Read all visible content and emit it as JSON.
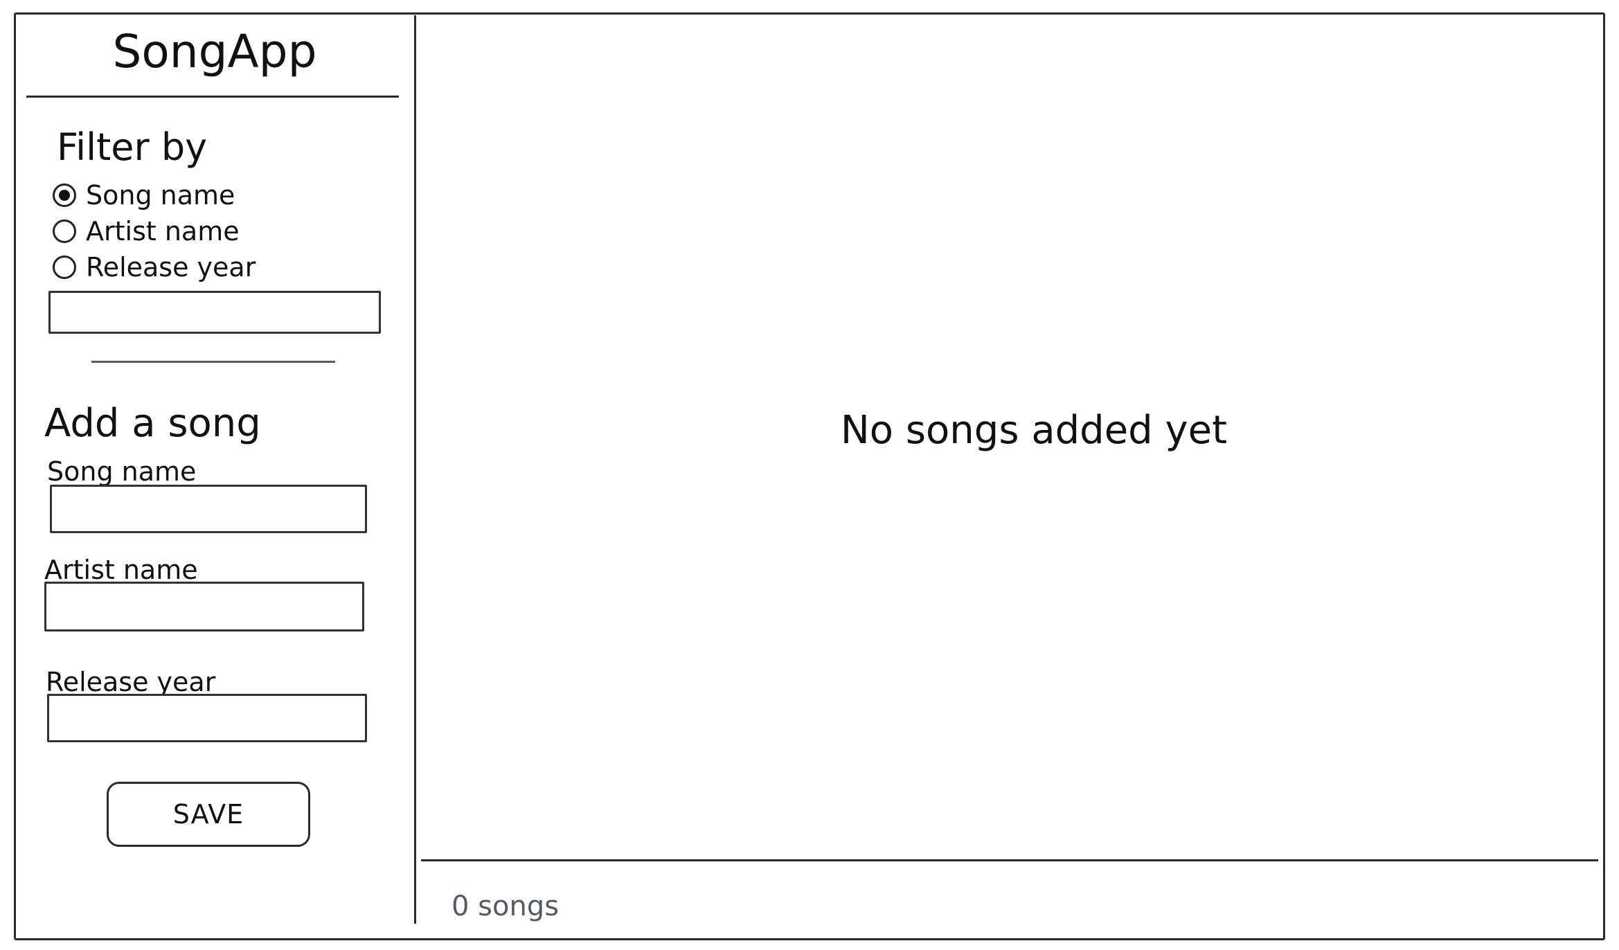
{
  "app": {
    "title": "SongApp"
  },
  "filter": {
    "title": "Filter by",
    "options": [
      {
        "label": "Song name",
        "selected": true
      },
      {
        "label": "Artist name",
        "selected": false
      },
      {
        "label": "Release year",
        "selected": false
      }
    ],
    "input_value": ""
  },
  "add_song": {
    "title": "Add a song",
    "song_name_label": "Song name",
    "artist_name_label": "Artist name",
    "release_year_label": "Release year",
    "song_name_value": "",
    "artist_name_value": "",
    "release_year_value": "",
    "save_label": "SAVE"
  },
  "main": {
    "empty_message": "No songs added yet",
    "song_count": "0 songs"
  }
}
